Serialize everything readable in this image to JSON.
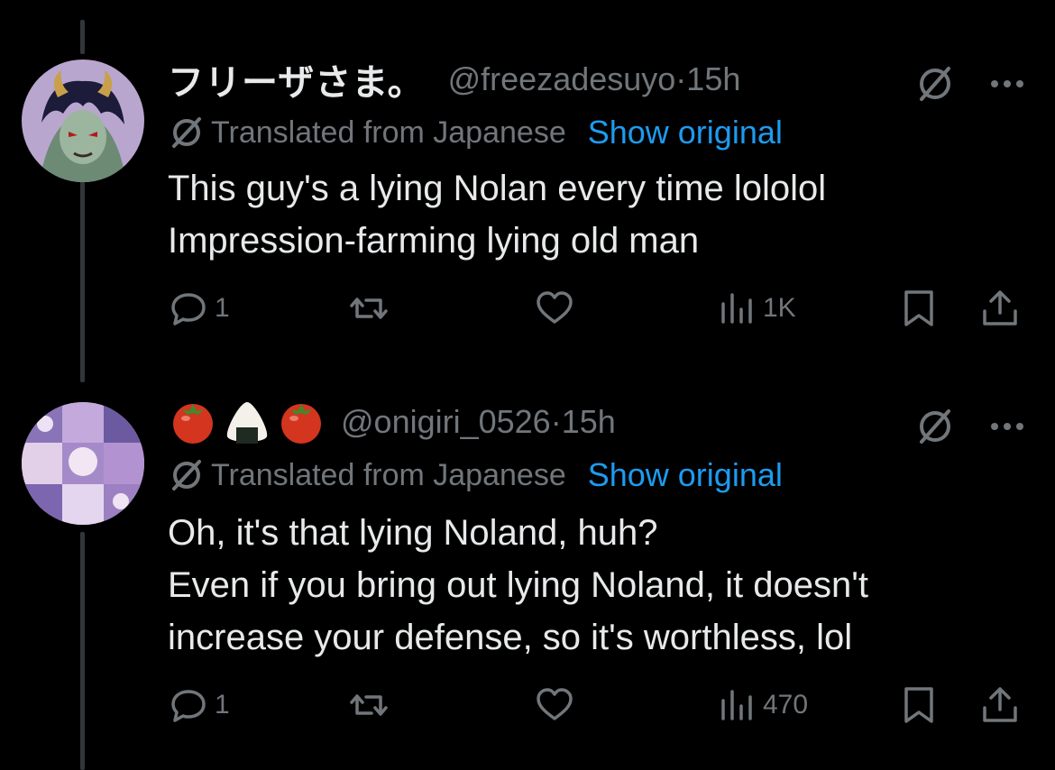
{
  "posts": [
    {
      "display_name": "フリーザさま。",
      "handle": "@freezadesuyo",
      "separator": "·",
      "time": "15h",
      "translated_label": "Translated from Japanese",
      "show_original": "Show original",
      "lines": [
        "This guy's a lying Nolan every time lololol",
        "Impression-farming lying old man"
      ],
      "replies": "1",
      "reposts": "",
      "likes": "",
      "views": "1K"
    },
    {
      "display_name_emoji": [
        "🍅",
        "🍙",
        "🍅"
      ],
      "handle": "@onigiri_0526",
      "separator": "·",
      "time": "15h",
      "translated_label": "Translated from Japanese",
      "show_original": "Show original",
      "lines": [
        "Oh, it's that lying Noland, huh?",
        "Even if you bring out lying Noland, it doesn't",
        "increase your defense, so it's worthless, lol"
      ],
      "replies": "1",
      "reposts": "",
      "likes": "",
      "views": "470"
    }
  ],
  "colors": {
    "background": "#000000",
    "text_primary": "#e7e9ea",
    "text_secondary": "#71767b",
    "link": "#1d9bf0",
    "thread_line": "#333639"
  },
  "icons": [
    "grok-icon",
    "more-icon",
    "translate-icon",
    "reply-icon",
    "repost-icon",
    "like-icon",
    "views-icon",
    "bookmark-icon",
    "share-icon"
  ]
}
